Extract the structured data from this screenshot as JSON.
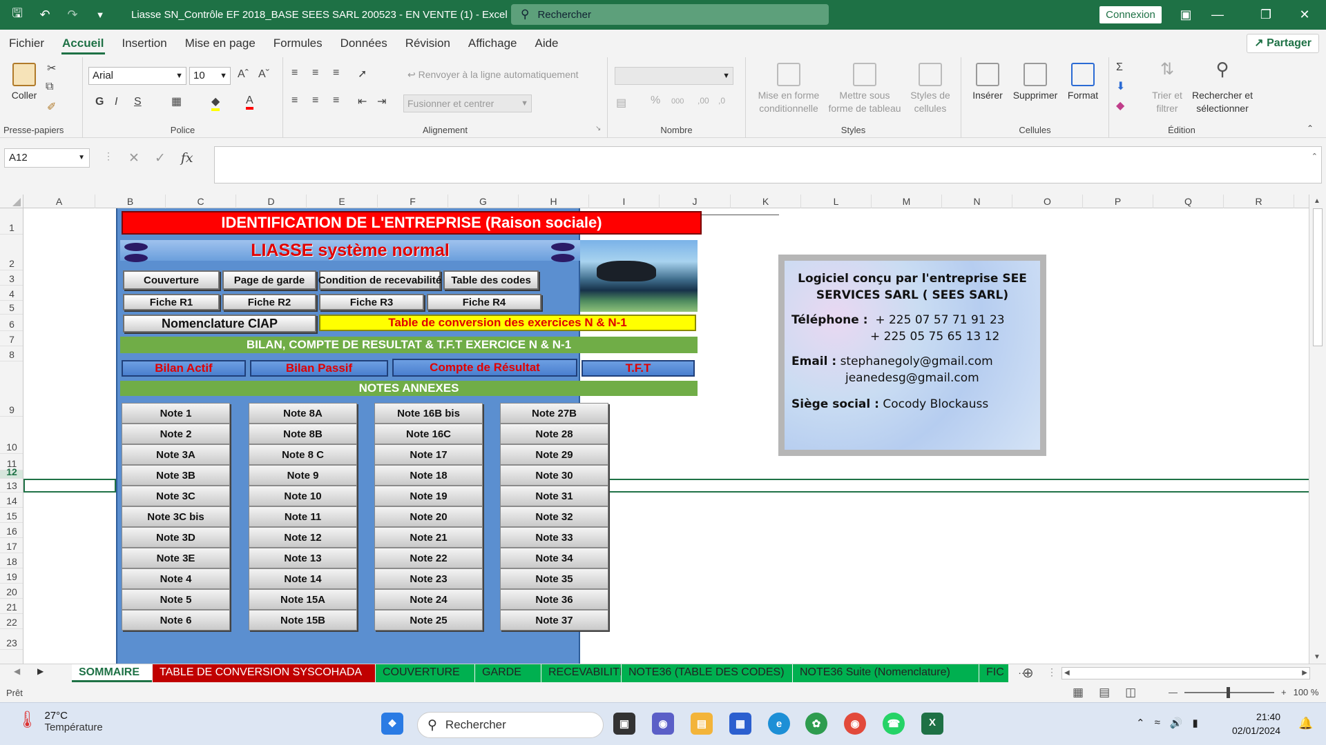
{
  "titlebar": {
    "title": "Liasse SN_Contrôle EF 2018_BASE SEES SARL 200523 - EN VENTE (1)  -  Excel",
    "search_placeholder": "Rechercher",
    "login": "Connexion"
  },
  "menu": {
    "tabs": [
      "Fichier",
      "Accueil",
      "Insertion",
      "Mise en page",
      "Formules",
      "Données",
      "Révision",
      "Affichage",
      "Aide"
    ],
    "active": "Accueil",
    "share": "Partager"
  },
  "ribbon": {
    "clipboard": {
      "paste": "Coller",
      "label": "Presse-papiers"
    },
    "font": {
      "name": "Arial",
      "size": "10",
      "label": "Police"
    },
    "alignment": {
      "wrap": "Renvoyer à la ligne automatiquement",
      "merge": "Fusionner et centrer",
      "label": "Alignement"
    },
    "number": {
      "label": "Nombre"
    },
    "styles": {
      "cond_format": "Mise en forme conditionnelle",
      "as_table": "Mettre sous forme de tableau",
      "cell_styles": "Styles de cellules",
      "label": "Styles"
    },
    "cells": {
      "insert": "Insérer",
      "delete": "Supprimer",
      "format": "Format",
      "label": "Cellules"
    },
    "editing": {
      "sort": "Trier et filtrer",
      "find": "Rechercher et sélectionner",
      "label": "Édition"
    }
  },
  "formula": {
    "namebox": "A12",
    "fx": "fx",
    "value": ""
  },
  "columns": [
    "A",
    "B",
    "C",
    "D",
    "E",
    "F",
    "G",
    "H",
    "I",
    "J",
    "K",
    "L",
    "M",
    "N",
    "O",
    "P",
    "Q",
    "R"
  ],
  "rows": [
    "1",
    "2",
    "3",
    "4",
    "5",
    "6",
    "7",
    "8",
    "9",
    "10",
    "11",
    "12",
    "13",
    "14",
    "15",
    "16",
    "17",
    "18",
    "19",
    "20",
    "21",
    "22",
    "23"
  ],
  "selected_row": "12",
  "sommaire": {
    "header": "IDENTIFICATION DE L'ENTREPRISE (Raison sociale)",
    "liasse": "LIASSE système normal",
    "top_buttons": [
      "Couverture",
      "Page de garde",
      "Condition de recevabilité",
      "Table des codes"
    ],
    "fiche_buttons": [
      "Fiche R1",
      "Fiche R2",
      "Fiche R3",
      "Fiche  R4"
    ],
    "nomenclature": "Nomenclature CIAP",
    "conversion": "Table de conversion  des exercices N & N-1",
    "bilan_band": "BILAN, COMPTE DE RESULTAT & T.F.T  EXERCICE  N & N-1",
    "statements": [
      "Bilan Actif",
      "Bilan Passif",
      "Compte de Résultat",
      "T.F.T"
    ],
    "notes_band": "NOTES ANNEXES",
    "notes_col1": [
      "Note 1",
      "Note 2",
      "Note 3A",
      "Note 3B",
      "Note 3C",
      "Note 3C bis",
      "Note 3D",
      "Note 3E",
      "Note 4",
      "Note 5",
      "Note 6"
    ],
    "notes_col2": [
      "Note 8A",
      "Note 8B",
      "Note 8 C",
      "Note 9",
      "Note 10",
      "Note 11",
      "Note 12",
      "Note 13",
      "Note 14",
      "Note 15A",
      "Note 15B"
    ],
    "notes_col3": [
      "Note 16B bis",
      "Note 16C",
      "Note 17",
      "Note 18",
      "Note 19",
      "Note 20",
      "Note 21",
      "Note 22",
      "Note 23",
      "Note 24",
      "Note 25"
    ],
    "notes_col4": [
      "Note 27B",
      "Note 28",
      "Note 29",
      "Note 30",
      "Note 31",
      "Note 32",
      "Note 33",
      "Note 34",
      "Note 35",
      "Note 36",
      "Note  37"
    ]
  },
  "infocard": {
    "title": "Logiciel conçu par l'entreprise SEE SERVICES SARL ( SEES SARL)",
    "phone_label": "Téléphone :",
    "phone1": "+ 225 07 57 71 91 23",
    "phone2": "+ 225 05 75 65 13 12",
    "email_label": "Email :",
    "email1": "stephanegoly@gmail.com",
    "email2": "jeanedesg@gmail.com",
    "hq_label": "Siège social :",
    "hq": "Cocody Blockauss"
  },
  "sheets": [
    {
      "name": "SOMMAIRE",
      "style": "active"
    },
    {
      "name": "TABLE DE CONVERSION SYSCOHADA",
      "style": "red"
    },
    {
      "name": "COUVERTURE",
      "style": "green"
    },
    {
      "name": "GARDE",
      "style": "green"
    },
    {
      "name": "RECEVABILITE",
      "style": "green"
    },
    {
      "name": "NOTE36 (TABLE DES CODES)",
      "style": "green"
    },
    {
      "name": "NOTE36 Suite (Nomenclature)",
      "style": "green"
    },
    {
      "name": "FIC",
      "style": "green"
    }
  ],
  "status": {
    "ready": "Prêt",
    "zoom": "100 %"
  },
  "taskbar": {
    "temp": "27°C",
    "temp_label": "Température",
    "search": "Rechercher",
    "time": "21:40",
    "date": "02/01/2024"
  },
  "colors": {
    "excel_green": "#1e7145",
    "panel_blue": "#5b8fd0",
    "header_red": "#ff0000",
    "band_green": "#70ad47"
  }
}
